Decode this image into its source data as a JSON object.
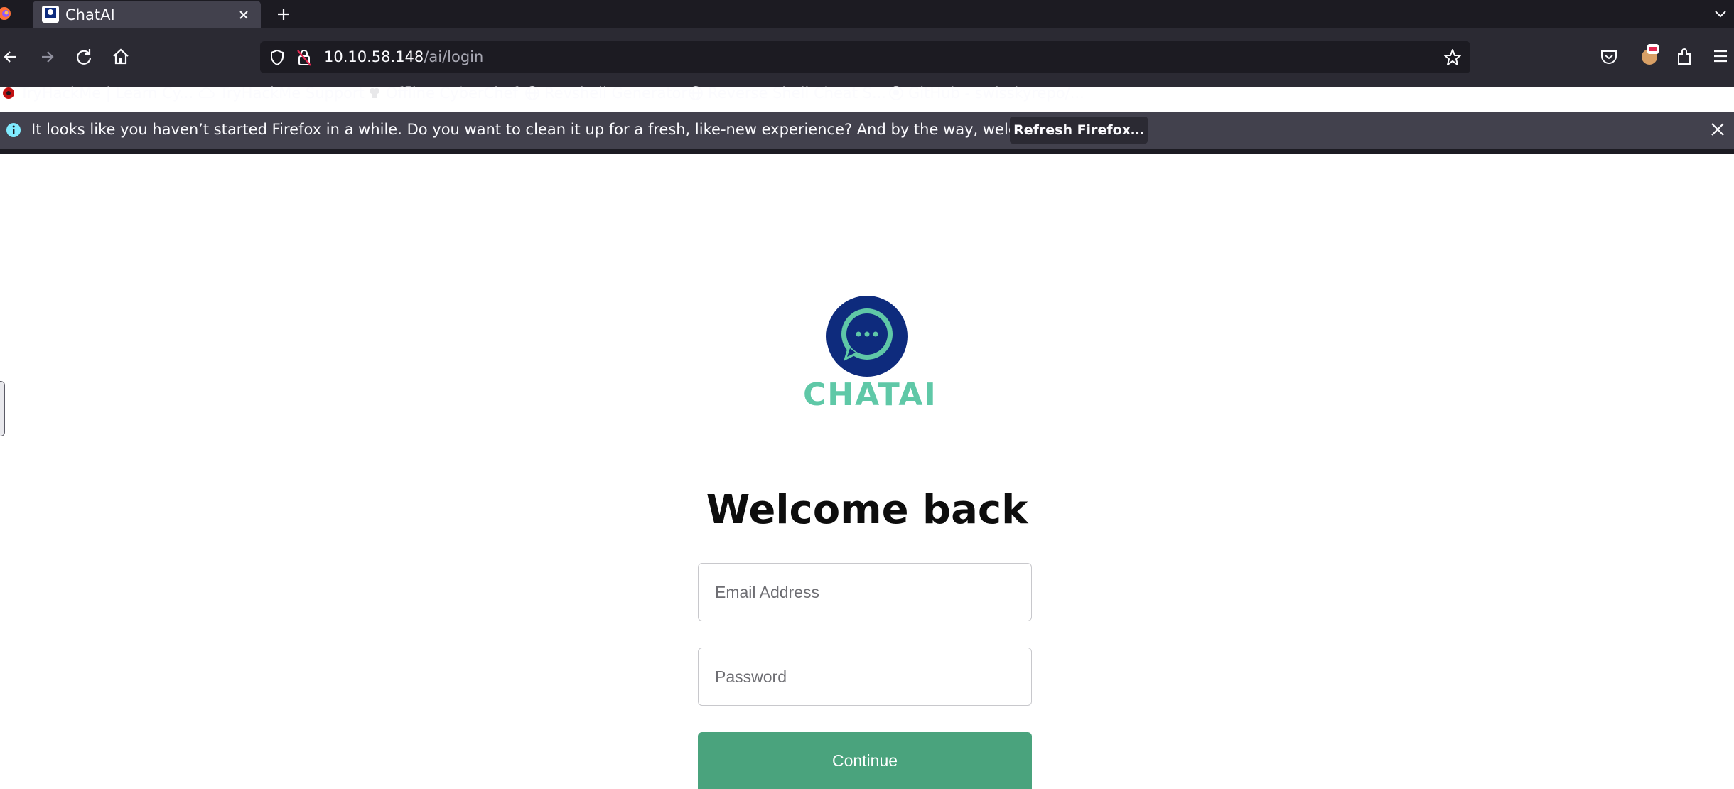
{
  "browser": {
    "tab": {
      "title": "ChatAI",
      "close_label": "×"
    },
    "new_tab_label": "+",
    "url": {
      "host": "10.10.58.148",
      "path": "/ai/login"
    },
    "bookmarks": [
      {
        "label": "TryHackMe | Learn Cy...",
        "icon": "tryhackme-icon"
      },
      {
        "label": "TryHackMe Support",
        "icon": "cloud-icon"
      },
      {
        "label": "Offline CyberChef",
        "icon": "chef-icon"
      },
      {
        "label": "Revshell Generator",
        "icon": "globe-icon"
      },
      {
        "label": "Reverse Shell Cheat S...",
        "icon": "globe-icon"
      },
      {
        "label": "GitHub - swisskyrepo/...",
        "icon": "github-icon"
      }
    ],
    "notification": {
      "message": "It looks like you haven’t started Firefox in a while. Do you want to clean it up for a fresh, like-new experience? And by the way, welcome back!",
      "button_label": "Refresh Firefox…"
    }
  },
  "page": {
    "logo_text": "CHATAI",
    "heading": "Welcome back",
    "email_placeholder": "Email Address",
    "password_placeholder": "Password",
    "continue_label": "Continue"
  },
  "colors": {
    "brand_navy": "#0e2b7d",
    "brand_teal": "#5fc8a7",
    "button_green": "#4aa37d"
  }
}
